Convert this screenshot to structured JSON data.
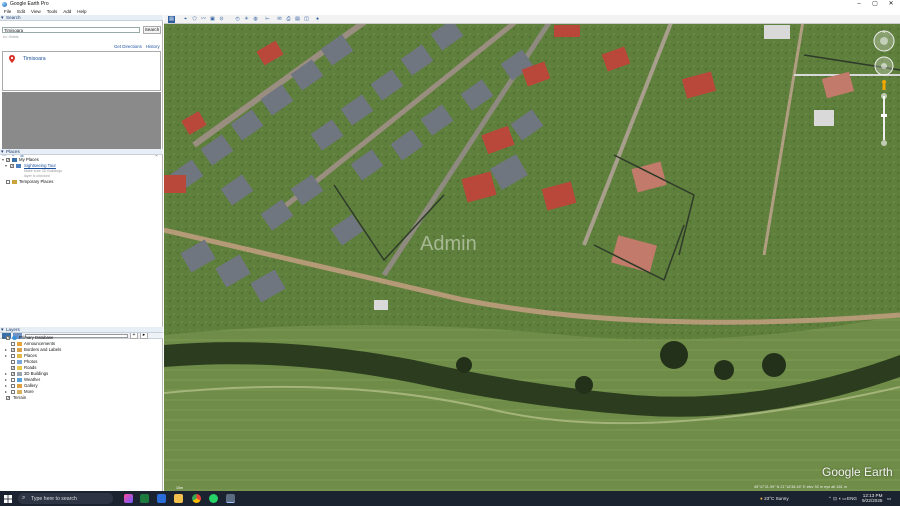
{
  "window": {
    "title": "Google Earth Pro"
  },
  "menu": [
    "File",
    "Edit",
    "View",
    "Tools",
    "Add",
    "Help"
  ],
  "search": {
    "header": "Search",
    "value": "Timisoara",
    "button": "Search",
    "hint": "ex: Hotels",
    "get_directions": "Get Directions",
    "history": "History",
    "result": "Timisoara"
  },
  "places": {
    "header": "Places",
    "items": [
      {
        "label": "My Places",
        "level": 0,
        "checked": true
      },
      {
        "label": "Sightseeing Tour",
        "level": 1,
        "checked": true,
        "link": true
      },
      {
        "label": "Make sure 3D Buildings",
        "level": 2,
        "sub": true
      },
      {
        "label": "layer is checked",
        "level": 2,
        "sub": true
      },
      {
        "label": "Temporary Places",
        "level": 0,
        "checked": false
      }
    ]
  },
  "layers": {
    "header": "Layers",
    "items": [
      {
        "label": "Primary Database",
        "level": 0,
        "checked": true,
        "icon": "globe-icon"
      },
      {
        "label": "Announcements",
        "level": 1,
        "checked": false,
        "icon": "announce-icon"
      },
      {
        "label": "Borders and Labels",
        "level": 1,
        "checked": true,
        "icon": "borders-icon"
      },
      {
        "label": "Places",
        "level": 1,
        "checked": false,
        "icon": "places-icon"
      },
      {
        "label": "Photos",
        "level": 1,
        "checked": false,
        "icon": "photos-icon"
      },
      {
        "label": "Roads",
        "level": 1,
        "checked": true,
        "icon": "roads-icon"
      },
      {
        "label": "3D Buildings",
        "level": 1,
        "checked": true,
        "icon": "buildings-icon"
      },
      {
        "label": "Weather",
        "level": 1,
        "checked": false,
        "icon": "weather-icon"
      },
      {
        "label": "Gallery",
        "level": 1,
        "checked": false,
        "icon": "gallery-icon"
      },
      {
        "label": "More",
        "level": 1,
        "checked": false,
        "icon": "more-icon"
      },
      {
        "label": "Terrain",
        "level": 0,
        "checked": true,
        "icon": ""
      }
    ]
  },
  "map": {
    "watermark": "Admin",
    "logo": "Google Earth",
    "scale": "10m",
    "status": "45°47'21.99\" N  21°16'38.18\" E  elev 92 m   eye alt 181 m"
  },
  "taskbar": {
    "search_placeholder": "Type here to search",
    "weather": "23°C  Sunny",
    "lang": "ENG",
    "time": "12:13 PM",
    "date": "9/22/2025"
  },
  "colors": {
    "accent": "#1a4f9c",
    "taskbar": "#1c2330"
  }
}
